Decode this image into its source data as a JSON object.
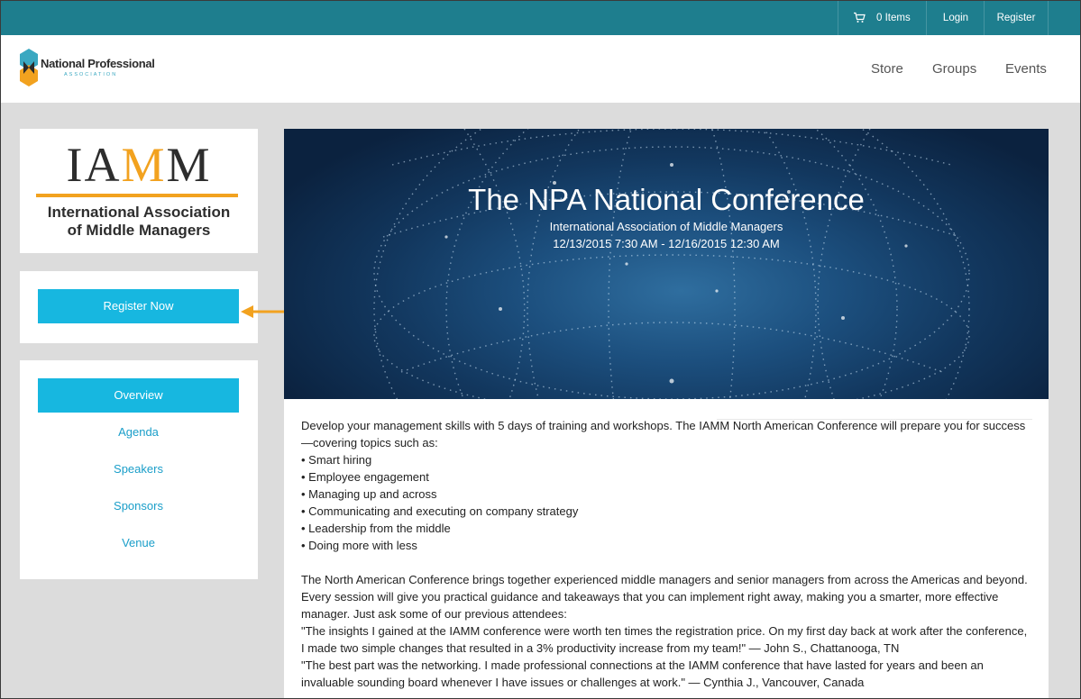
{
  "topbar": {
    "cart_label": "0 Items",
    "login_label": "Login",
    "register_label": "Register"
  },
  "header": {
    "logo_name": "National Professional",
    "logo_sub": "ASSOCIATION",
    "nav": [
      "Store",
      "Groups",
      "Events"
    ]
  },
  "sidebar": {
    "org_logo_letters": "IAMM",
    "org_name_line1": "International Association",
    "org_name_line2": "of Middle Managers",
    "register_button": "Register Now",
    "menu": [
      "Overview",
      "Agenda",
      "Speakers",
      "Sponsors",
      "Venue"
    ],
    "active_menu": "Overview"
  },
  "hero": {
    "title": "The NPA National Conference",
    "organizer": "International Association of Middle Managers",
    "dates": "12/13/2015 7:30 AM - 12/16/2015 12:30 AM"
  },
  "content": {
    "intro": "Develop your management skills with 5 days of training and workshops. The IAMM North American Conference will prepare you for success—covering topics such as:",
    "topics": [
      "• Smart hiring",
      "• Employee engagement",
      "• Managing up and across",
      "• Communicating and executing on company strategy",
      "• Leadership from the middle",
      "• Doing more with less"
    ],
    "body": "The North American Conference brings together experienced middle managers and senior managers from across the Americas and beyond. Every session will give you practical guidance and takeaways that you can implement right away, making you a smarter, more effective manager. Just ask some of our previous attendees:",
    "quote1": "\"The insights I gained at the IAMM conference were worth ten times the registration price. On my first day back at work after the conference, I made two simple changes that resulted in a 3% productivity increase from my team!\" — John S., Chattanooga, TN",
    "quote2": "\"The best part was the networking. I made professional connections at the IAMM conference that have lasted for years and been an invaluable sounding board whenever I have issues or challenges at work.\" — Cynthia J., Vancouver, Canada"
  },
  "colors": {
    "topbar": "#1e7e8e",
    "accent": "#17b7e0",
    "link": "#1a9ec9",
    "iamm_orange": "#f2a21f"
  }
}
